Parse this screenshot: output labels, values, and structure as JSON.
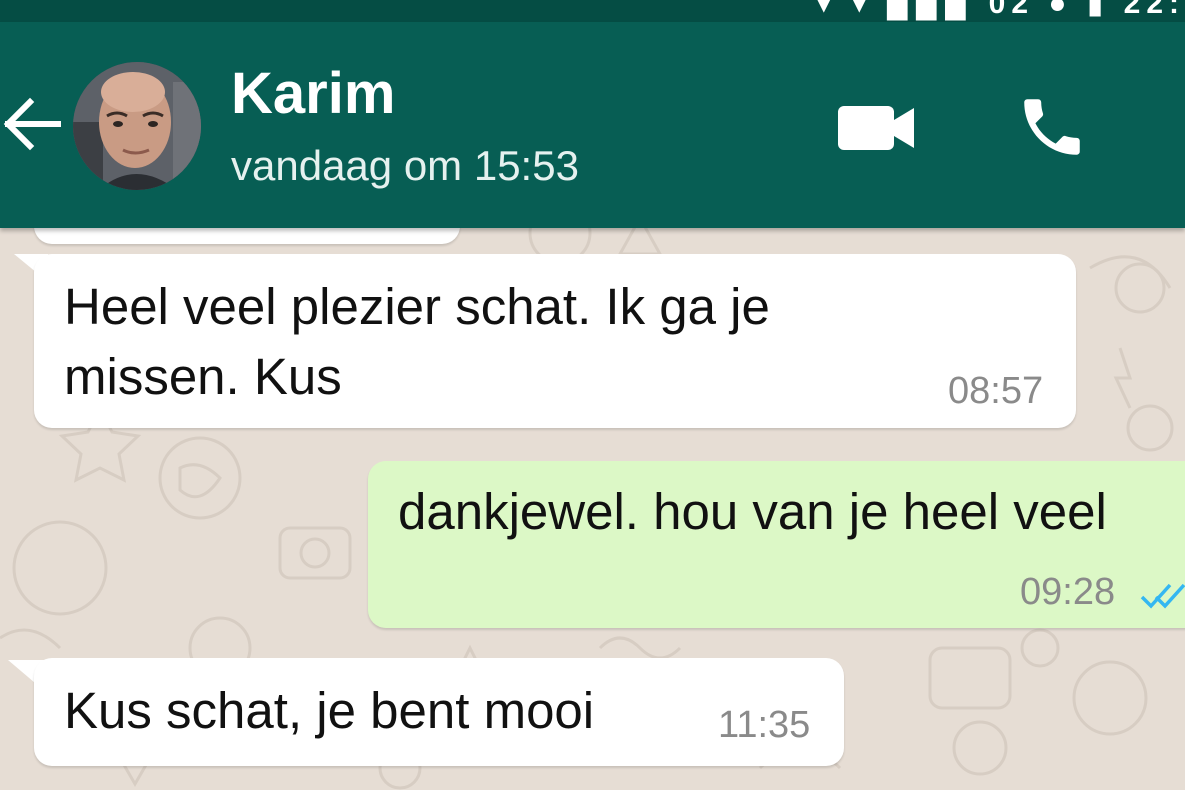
{
  "status_bar": {
    "glyphs": "▾ ▾ ▉▉▉ 02 ● ▮ 22:"
  },
  "header": {
    "contact_name": "Karim",
    "last_seen": "vandaag om 15:53",
    "colors": {
      "bar": "#075e54",
      "status_bar": "#054d44"
    },
    "icons": {
      "back": "arrow-left-icon",
      "video": "videocam-icon",
      "call": "phone-icon",
      "avatar": "contact-photo"
    }
  },
  "chat": {
    "background_color": "#e6ddd4",
    "messages": [
      {
        "direction": "incoming",
        "lines": [
          "Heel veel plezier schat. Ik ga je",
          "missen. Kus"
        ],
        "time": "08:57"
      },
      {
        "direction": "outgoing",
        "lines": [
          "dankjewel. hou van je heel veel"
        ],
        "time": "09:28",
        "status": "read",
        "status_icon": "double-check-icon",
        "status_color": "#34b7f1"
      },
      {
        "direction": "incoming",
        "lines": [
          "Kus schat, je bent mooi"
        ],
        "time": "11:35"
      }
    ]
  }
}
